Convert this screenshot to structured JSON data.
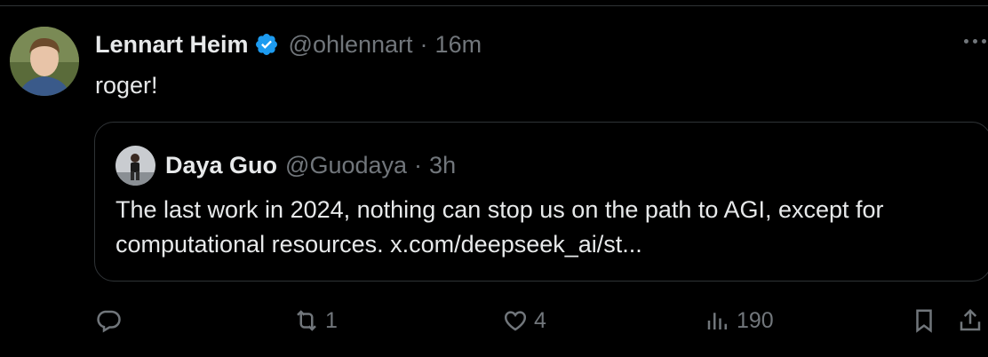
{
  "tweet": {
    "author_name": "Lennart Heim",
    "author_handle": "@ohlennart",
    "separator": "·",
    "time": "16m",
    "text": "roger!",
    "verified": true
  },
  "quoted": {
    "author_name": "Daya Guo",
    "author_handle": "@Guodaya",
    "separator": "·",
    "time": "3h",
    "text": "The last work in 2024, nothing can stop us on the path to AGI, except for computational resources. x.com/deepseek_ai/st..."
  },
  "actions": {
    "reply_count": "",
    "retweet_count": "1",
    "like_count": "4",
    "views_count": "190"
  },
  "icons": [
    "verified-badge-icon",
    "more-icon",
    "reply-icon",
    "retweet-icon",
    "like-icon",
    "views-icon",
    "bookmark-icon",
    "share-icon"
  ],
  "colors": {
    "background": "#000000",
    "primary_text": "#e7e9ea",
    "secondary_text": "#71767b",
    "verified_blue": "#1d9bf0",
    "border": "#2f3336"
  }
}
